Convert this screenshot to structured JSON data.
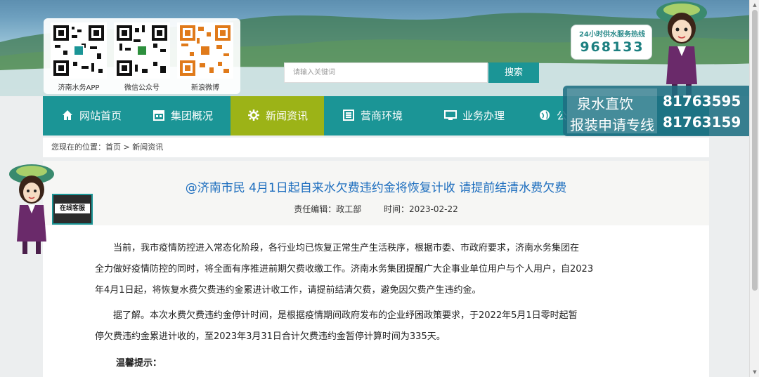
{
  "header": {
    "qr_codes": [
      {
        "label": "济南水务APP"
      },
      {
        "label": "微信公众号"
      },
      {
        "label": "新浪微博"
      }
    ],
    "search": {
      "placeholder": "请输入关键词",
      "button_label": "搜索"
    },
    "hotline": {
      "label": "24小时供水服务热线",
      "number": "968133"
    }
  },
  "nav": {
    "items": [
      {
        "label": "网站首页",
        "icon": "home-icon"
      },
      {
        "label": "集团概况",
        "icon": "calendar-icon"
      },
      {
        "label": "新闻资讯",
        "icon": "gear-icon",
        "active": true
      },
      {
        "label": "营商环境",
        "icon": "list-icon"
      },
      {
        "label": "业务办理",
        "icon": "monitor-icon"
      },
      {
        "label": "公",
        "icon": "globe-icon"
      }
    ]
  },
  "promo": {
    "line1": "泉水直饮",
    "line2": "报装申请专线",
    "number1": "81763595",
    "number2": "81763159"
  },
  "breadcrumb": {
    "text": "您现在的位置：首页 > 新闻资讯"
  },
  "service": {
    "label": "在线客服"
  },
  "article": {
    "title": "@济南市民 4月1日起自来水欠费违约金将恢复计收 请提前结清水费欠费",
    "editor": "责任编辑：政工部",
    "time": "时间：2023-02-22",
    "paragraph1_line1": "当前，我市疫情防控进入常态化阶段，各行业均已恢复正常生产生活秩序，根据市委、市政府要求，济南水务集团在",
    "paragraph1_line2": "全力做好疫情防控的同时，将全面有序推进前期欠费收缴工作。济南水务集团提醒广大企事业单位用户与个人用户，自2023",
    "paragraph1_line3": "年4月1日起，将恢复水费欠费违约金累进计收工作，请提前结清欠费，避免因欠费产生违约金。",
    "paragraph2_line1": "据了解。本次水费欠费违约金停计时间，是根据疫情期间政府发布的企业纾困政策要求，于2022年5月1日零时起暂",
    "paragraph2_line2": "停欠费违约金累进计收的，至2023年3月31日合计欠费违约金暂停计算时间为335天。",
    "tip": "温馨提示："
  },
  "colors": {
    "nav": "#1b9596",
    "nav_active": "#9cb317",
    "title": "#1c6dbe"
  }
}
